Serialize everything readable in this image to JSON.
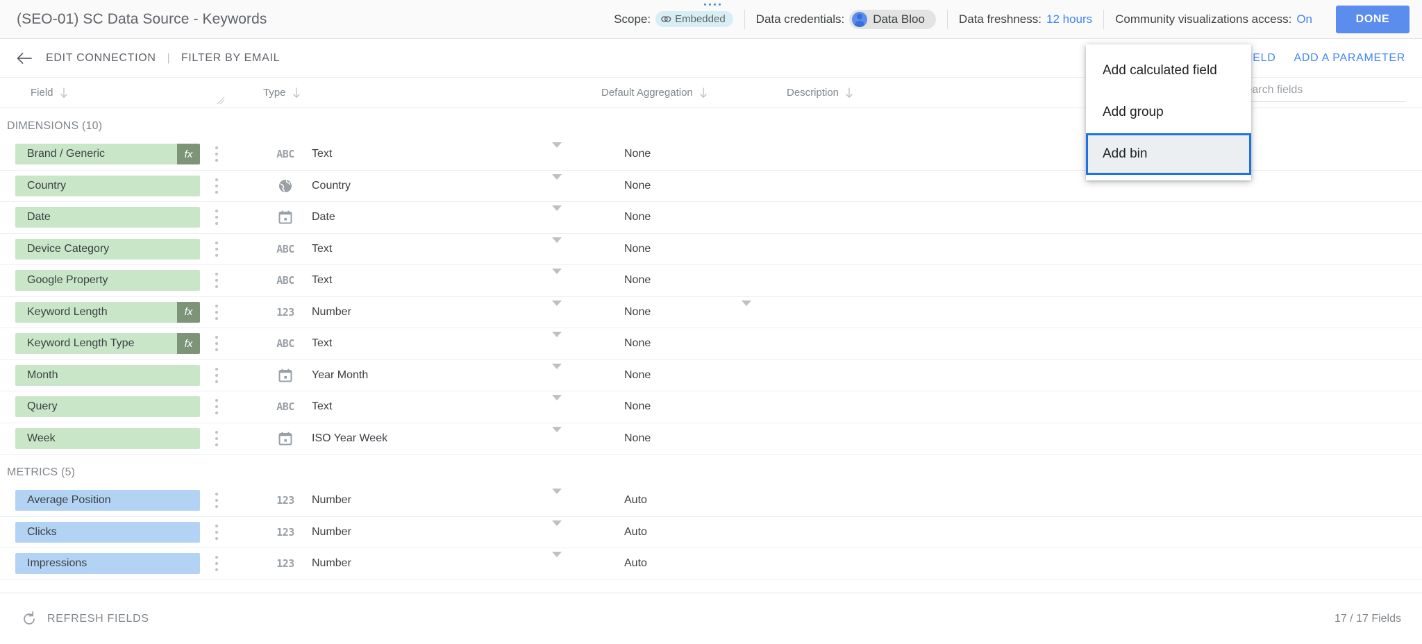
{
  "header": {
    "data_source_title": "(SEO-01) SC Data Source - Keywords",
    "scope_label": "Scope:",
    "scope_value": "Embedded",
    "credentials_label": "Data credentials:",
    "credentials_value": "Data Bloo",
    "freshness_label": "Data freshness:",
    "freshness_value": "12 hours",
    "community_label": "Community visualizations access:",
    "community_value": "On",
    "done_label": "DONE",
    "accent_blue": "#5b8def",
    "scope_chip_bg": "#d7eff4",
    "credentials_chip_bg": "#e3e3e3"
  },
  "toolbar": {
    "back_icon": "arrow-left-icon",
    "edit_connection_label": "EDIT CONNECTION",
    "separator": "|",
    "filter_by_email_label": "FILTER BY EMAIL",
    "add_a_field_label": "ADD A FIELD",
    "add_a_parameter_label": "ADD A PARAMETER",
    "link_color": "#4285f4"
  },
  "menu": {
    "items": [
      {
        "label": "Add calculated field",
        "focused": false
      },
      {
        "label": "Add group",
        "focused": false
      },
      {
        "label": "Add bin",
        "focused": true
      }
    ],
    "focus_outline_color": "#1a73e8"
  },
  "columns": {
    "field": "Field",
    "type": "Type",
    "default_aggregation": "Default Aggregation",
    "description": "Description",
    "sort_icon": "sort-down-arrow-icon"
  },
  "search": {
    "placeholder": "Search fields",
    "value": "",
    "icon": "search-icon"
  },
  "sections": [
    {
      "title": "DIMENSIONS (10)",
      "kind": "dimension",
      "rows": [
        {
          "name": "Brand / Generic",
          "fx": true,
          "type_icon": "ABC",
          "type": "Text",
          "aggregation": "None",
          "agg_caret": false
        },
        {
          "name": "Country",
          "fx": false,
          "type_icon": "globe",
          "type": "Country",
          "aggregation": "None",
          "agg_caret": false
        },
        {
          "name": "Date",
          "fx": false,
          "type_icon": "calendar",
          "type": "Date",
          "aggregation": "None",
          "agg_caret": false
        },
        {
          "name": "Device Category",
          "fx": false,
          "type_icon": "ABC",
          "type": "Text",
          "aggregation": "None",
          "agg_caret": false
        },
        {
          "name": "Google Property",
          "fx": false,
          "type_icon": "ABC",
          "type": "Text",
          "aggregation": "None",
          "agg_caret": false
        },
        {
          "name": "Keyword Length",
          "fx": true,
          "type_icon": "123",
          "type": "Number",
          "aggregation": "None",
          "agg_caret": true
        },
        {
          "name": "Keyword Length Type",
          "fx": true,
          "type_icon": "ABC",
          "type": "Text",
          "aggregation": "None",
          "agg_caret": false
        },
        {
          "name": "Month",
          "fx": false,
          "type_icon": "calendar",
          "type": "Year Month",
          "aggregation": "None",
          "agg_caret": false
        },
        {
          "name": "Query",
          "fx": false,
          "type_icon": "ABC",
          "type": "Text",
          "aggregation": "None",
          "agg_caret": false
        },
        {
          "name": "Week",
          "fx": false,
          "type_icon": "calendar",
          "type": "ISO Year Week",
          "aggregation": "None",
          "agg_caret": false
        }
      ]
    },
    {
      "title": "METRICS (5)",
      "kind": "metric",
      "rows": [
        {
          "name": "Average Position",
          "fx": false,
          "type_icon": "123",
          "type": "Number",
          "aggregation": "Auto",
          "agg_caret": false
        },
        {
          "name": "Clicks",
          "fx": false,
          "type_icon": "123",
          "type": "Number",
          "aggregation": "Auto",
          "agg_caret": false
        },
        {
          "name": "Impressions",
          "fx": false,
          "type_icon": "123",
          "type": "Number",
          "aggregation": "Auto",
          "agg_caret": false
        }
      ]
    }
  ],
  "footer": {
    "refresh_label": "REFRESH FIELDS",
    "refresh_icon": "refresh-icon",
    "field_count": "17 / 17 Fields"
  }
}
